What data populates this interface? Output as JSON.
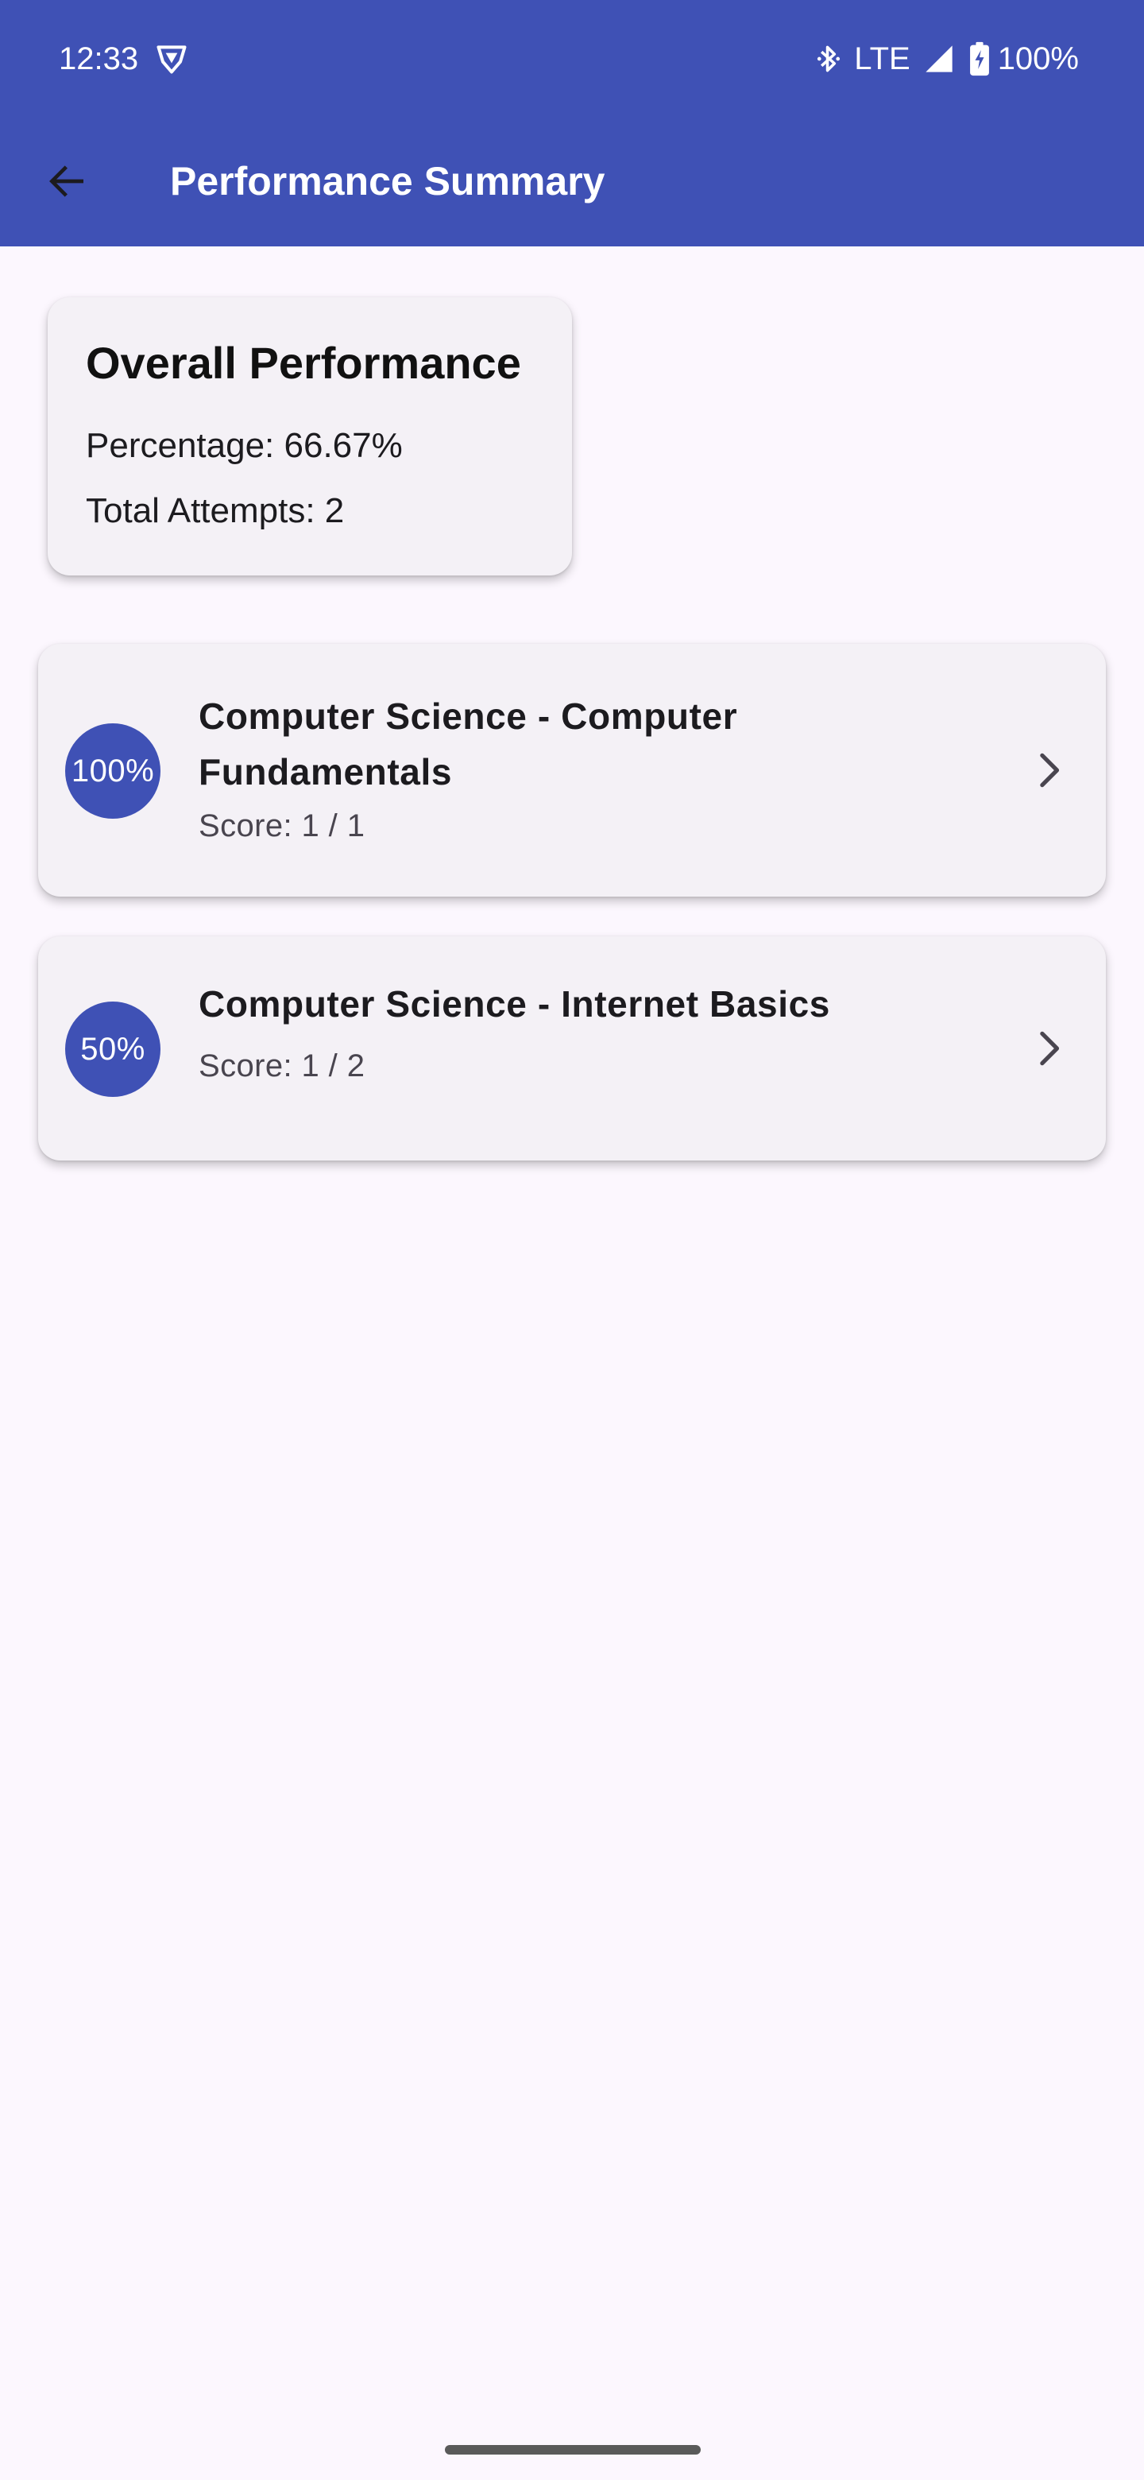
{
  "status_bar": {
    "time": "12:33",
    "network": "LTE",
    "battery": "100%",
    "icons": [
      "vpn-shield-icon",
      "bluetooth-icon",
      "signal-icon",
      "battery-charging-icon"
    ]
  },
  "app_bar": {
    "title": "Performance Summary",
    "back_icon": "arrow-back-icon"
  },
  "overall": {
    "title": "Overall Performance",
    "percentage_text": "Percentage: 66.67%",
    "attempts_text": "Total Attempts: 2"
  },
  "topics": [
    {
      "badge": "100%",
      "title": "Computer Science - Computer Fundamentals",
      "score": "Score: 1 / 1"
    },
    {
      "badge": "50%",
      "title": "Computer Science - Internet Basics",
      "score": "Score: 1 / 2"
    }
  ],
  "colors": {
    "primary": "#3f51b5",
    "background": "#fcf7fe",
    "card": "#f4f1f6"
  }
}
